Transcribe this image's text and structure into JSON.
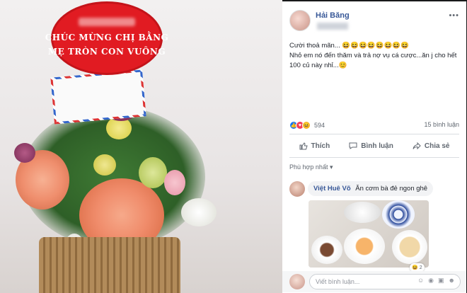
{
  "photo": {
    "sign_line1": "CHÚC MỪNG CHỊ BẰNG",
    "sign_line2": "MẸ TRÒN CON VUÔNG"
  },
  "post": {
    "author": "Hải Băng",
    "more_icon": "more-dots-icon",
    "text_lines": [
      "Cười thoả mãn... 😆😆😆😆😆😆😆😆",
      "Nhỏ em nó đến thăm và trả nợ vụ cá cược...ăn j cho hết 100 củ này nhỉ...😊"
    ],
    "reaction_count": "594",
    "comment_count": "15 bình luận",
    "actions": {
      "like": "Thích",
      "comment": "Bình luận",
      "share": "Chia sẻ"
    },
    "filter_label": "Phù hợp nhất ▾"
  },
  "comment": {
    "author": "Việt Huê Võ",
    "text": "Ăn cơm bà đẻ ngon ghê",
    "reaction_count": "2"
  },
  "writebar": {
    "placeholder": "Viết bình luận..."
  },
  "colors": {
    "link": "#385898",
    "muted": "#606770",
    "sign_red": "#e11b22"
  }
}
